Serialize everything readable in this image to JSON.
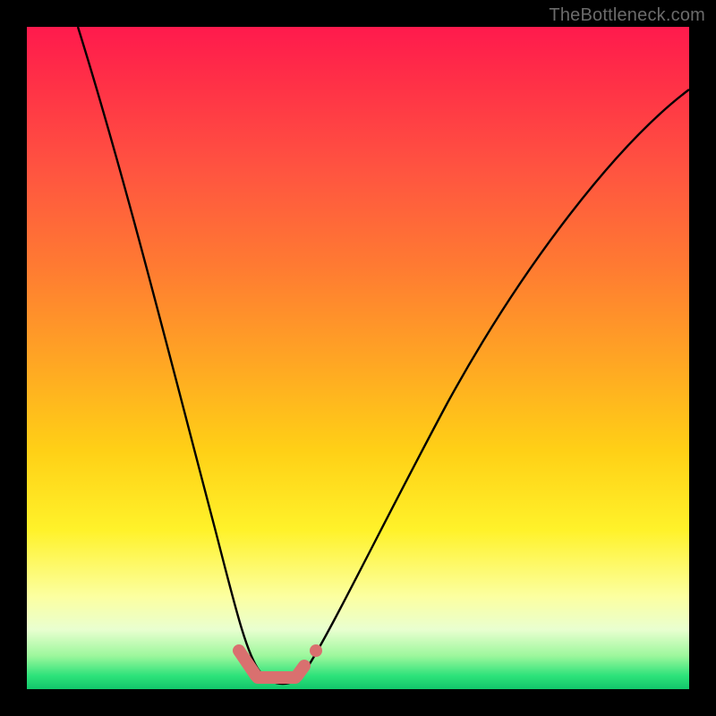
{
  "watermark": "TheBottleneck.com",
  "chart_data": {
    "type": "line",
    "title": "",
    "xlabel": "",
    "ylabel": "",
    "xlim": [
      0,
      100
    ],
    "ylim": [
      0,
      100
    ],
    "grid": false,
    "legend": false,
    "background_gradient": {
      "direction": "vertical",
      "stops": [
        {
          "pos": 0.0,
          "color": "#ff1a4d"
        },
        {
          "pos": 0.22,
          "color": "#ff5540"
        },
        {
          "pos": 0.5,
          "color": "#ffa424"
        },
        {
          "pos": 0.76,
          "color": "#fff22a"
        },
        {
          "pos": 0.91,
          "color": "#e9ffd0"
        },
        {
          "pos": 1.0,
          "color": "#12c66a"
        }
      ]
    },
    "series": [
      {
        "name": "curve",
        "color": "#000000",
        "stroke_width": 2,
        "x": [
          0,
          5,
          10,
          15,
          20,
          25,
          28,
          30,
          32,
          33,
          34,
          36,
          38,
          40,
          42,
          45,
          50,
          55,
          60,
          65,
          70,
          75,
          80,
          85,
          90,
          95,
          100
        ],
        "values": [
          100,
          88,
          75,
          62,
          48,
          33,
          22,
          14,
          7,
          3,
          1,
          0,
          0,
          0,
          1,
          4,
          10,
          18,
          26,
          34,
          42,
          49,
          56,
          62,
          67,
          71,
          74
        ]
      },
      {
        "name": "bottom-marks",
        "color": "#d9706f",
        "type": "scatter",
        "x": [
          31.5,
          33.0,
          34.5,
          36.0,
          37.5,
          39.0,
          40.5,
          42.0
        ],
        "values": [
          3.4,
          2.0,
          1.4,
          1.2,
          1.2,
          1.3,
          1.8,
          3.8
        ]
      }
    ],
    "note": "No numeric axis ticks are drawn in the image; values are read off on a 0–100 normalized scale in both axes, estimated from curve geometry."
  }
}
